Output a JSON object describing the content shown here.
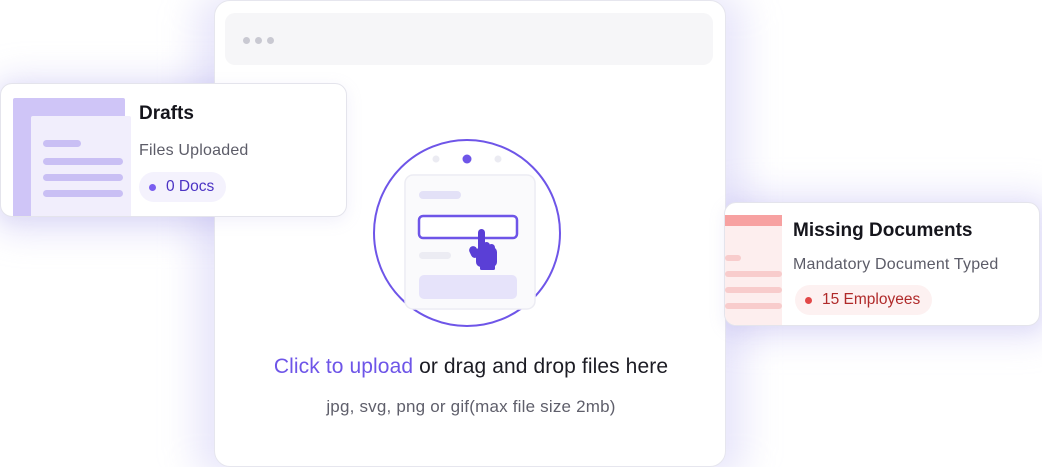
{
  "window": {
    "dots": [
      "dot",
      "dot",
      "dot"
    ]
  },
  "upload": {
    "link_label": "Click to upload",
    "rest_label": " or drag and drop files here",
    "formats_label": "jpg, svg, png or gif(max file size 2mb)"
  },
  "icons": {
    "window_dots": "ellipsis-icon",
    "illustration": "upload-form-illustration",
    "hand": "pointer-hand-icon",
    "drafts_doc": "document-stack-icon",
    "missing_doc": "document-icon"
  },
  "drafts_card": {
    "title": "Drafts",
    "subtitle": "Files Uploaded",
    "badge": "0 Docs"
  },
  "missing_card": {
    "title": "Missing Documents",
    "subtitle": "Mandatory Document Typed",
    "badge": "15 Employees"
  },
  "colors": {
    "accent": "#6e55e8",
    "drafts_badge_bg": "#f4f2fd",
    "drafts_badge_text": "#4b33c4",
    "missing_badge_bg": "#fdf1f1",
    "missing_badge_text": "#b02a2a",
    "missing_dot": "#e24848"
  }
}
